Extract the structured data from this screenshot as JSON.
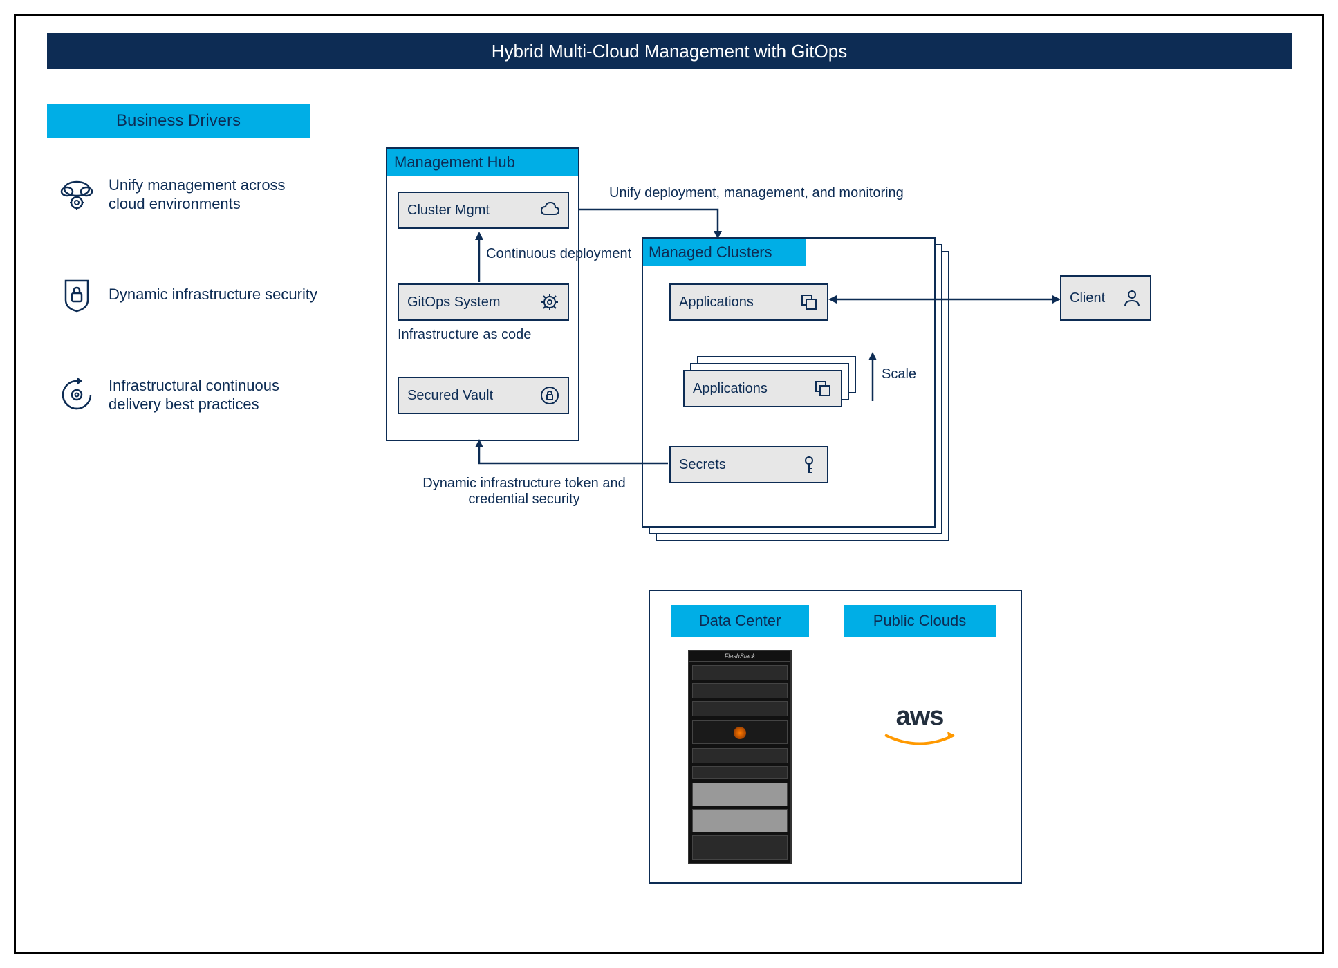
{
  "title": "Hybrid Multi-Cloud Management with GitOps",
  "business_drivers": {
    "header": "Business Drivers",
    "items": [
      "Unify management across cloud environments",
      "Dynamic infrastructure security",
      "Infrastructural continuous delivery best practices"
    ]
  },
  "management_hub": {
    "header": "Management Hub",
    "cluster_mgmt": "Cluster Mgmt",
    "gitops_system": "GitOps System",
    "secured_vault": "Secured Vault",
    "infra_as_code_label": "Infrastructure as code",
    "continuous_deploy_label": "Continuous deployment"
  },
  "managed_clusters": {
    "header": "Managed Clusters",
    "applications": "Applications",
    "secrets": "Secrets",
    "scale_label": "Scale"
  },
  "client": "Client",
  "connections": {
    "unify_label": "Unify deployment, management, and monitoring",
    "vault_label": "Dynamic infrastructure token and credential security"
  },
  "infrastructure": {
    "data_center": "Data Center",
    "public_clouds": "Public Clouds",
    "rack_label": "FlashStack",
    "cloud_provider": "aws"
  }
}
